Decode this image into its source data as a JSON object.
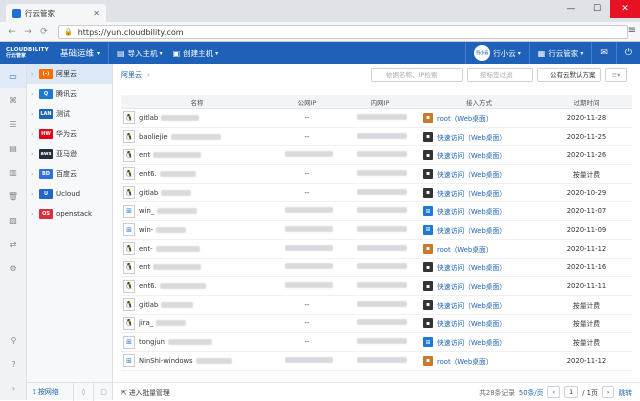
{
  "browser": {
    "tab_title": "行云管家",
    "url": "https://yun.cloudbility.com"
  },
  "app": {
    "logo_text": "CLOUDBILITY",
    "logo_sub": "行云管家",
    "title": "基础运维",
    "import_host": "导入主机",
    "create_host": "创建主机",
    "user_name": "行小云",
    "user_initials": "行小云",
    "product": "行云管家"
  },
  "clouds": [
    {
      "label": "阿里云",
      "color": "#ff6a00",
      "abbr": "(-)"
    },
    {
      "label": "腾讯云",
      "color": "#1e78d6",
      "abbr": "Q"
    },
    {
      "label": "测试",
      "color": "#1d62b8",
      "abbr": "LAN"
    },
    {
      "label": "华为云",
      "color": "#e60012",
      "abbr": "HW"
    },
    {
      "label": "亚马逊",
      "color": "#232f3e",
      "abbr": "aws"
    },
    {
      "label": "百度云",
      "color": "#2f6fe0",
      "abbr": "BD"
    },
    {
      "label": "Ucloud",
      "color": "#2266cc",
      "abbr": "U"
    },
    {
      "label": "openstack",
      "color": "#d9313b",
      "abbr": "OS"
    }
  ],
  "sidebar_bottom": {
    "label": "按网络"
  },
  "breadcrumb": "阿里云",
  "filters": {
    "search_placeholder": "依据名称、IP检索",
    "tag_placeholder": "按标签过滤",
    "account": "公有云默认方案"
  },
  "columns": {
    "name": "名称",
    "public_ip": "公网IP",
    "private_ip": "内网IP",
    "access": "接入方式",
    "expire": "过期时间"
  },
  "rows": [
    {
      "os": "linux",
      "name": "gitlab",
      "pub": "--",
      "acc": "mac",
      "access": "root（Web桌面）",
      "expire": "2020-11-28"
    },
    {
      "os": "linux",
      "name": "baoliejie",
      "pub": "--",
      "acc": "lin",
      "access": "快速访问（Web桌面）",
      "expire": "2020-11-25"
    },
    {
      "os": "linux",
      "name": "ent",
      "pub": "",
      "acc": "lin",
      "access": "快速访问（Web桌面）",
      "expire": "2020-11-26"
    },
    {
      "os": "linux",
      "name": "ent6.",
      "pub": "--",
      "acc": "lin",
      "access": "快速访问（Web桌面）",
      "expire": "按量计费"
    },
    {
      "os": "linux",
      "name": "gitlab",
      "pub": "--",
      "acc": "lin",
      "access": "快速访问（Web桌面）",
      "expire": "2020-10-29"
    },
    {
      "os": "win",
      "name": "win_",
      "pub": "",
      "acc": "win",
      "access": "快速访问（Web桌面）",
      "expire": "2020-11-07"
    },
    {
      "os": "win",
      "name": "win-",
      "pub": "",
      "acc": "win",
      "access": "快速访问（Web桌面）",
      "expire": "2020-11-09"
    },
    {
      "os": "linux",
      "name": "ent-",
      "pub": "",
      "acc": "mac",
      "access": "root（Web桌面）",
      "expire": "2020-11-12"
    },
    {
      "os": "linux",
      "name": "ent",
      "pub": "",
      "acc": "lin",
      "access": "快速访问（Web桌面）",
      "expire": "2020-11-16"
    },
    {
      "os": "linux",
      "name": "ent6.",
      "pub": "",
      "acc": "lin",
      "access": "快速访问（Web桌面）",
      "expire": "2020-11-11"
    },
    {
      "os": "linux",
      "name": "gitlab",
      "pub": "--",
      "acc": "lin",
      "access": "快速访问（Web桌面）",
      "expire": "按量计费"
    },
    {
      "os": "linux",
      "name": "jira_",
      "pub": "--",
      "acc": "lin",
      "access": "快速访问（Web桌面）",
      "expire": "按量计费"
    },
    {
      "os": "win",
      "name": "tongjun",
      "pub": "--",
      "acc": "win",
      "access": "快速访问（Web桌面）",
      "expire": "按量计费"
    },
    {
      "os": "win",
      "name": "NinShi-windows",
      "pub": "",
      "acc": "mac",
      "access": "root（Web桌面）",
      "expire": "2020-11-12"
    }
  ],
  "footer": {
    "batch": "进入批量管理",
    "total": "共28条记录",
    "per_page": "50条/页",
    "page": "1",
    "of": "/ 1页",
    "jump": "跳转"
  }
}
